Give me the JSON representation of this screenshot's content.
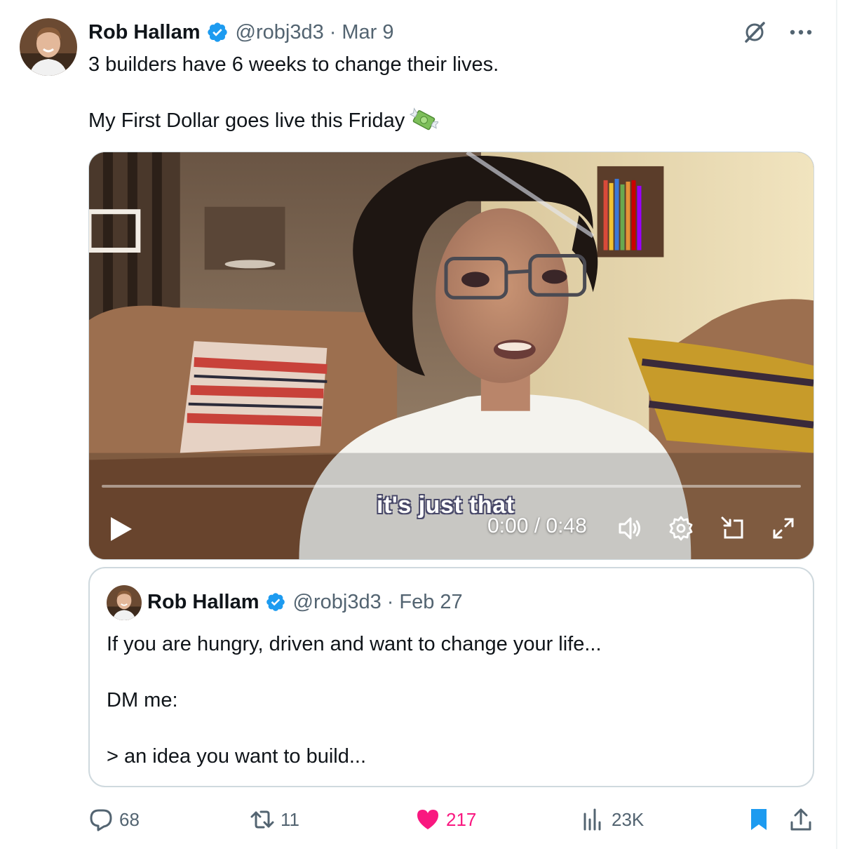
{
  "tweet": {
    "author_name": "Rob Hallam",
    "handle": "@robj3d3",
    "separator": "·",
    "date": "Mar 9",
    "text_line1": "3 builders have 6 weeks to change their lives.",
    "text_line2": "My First Dollar goes live this Friday",
    "emoji": "money-with-wings-icon"
  },
  "video": {
    "caption": "it's just that",
    "time": "0:00 / 0:48",
    "progress": 0
  },
  "quote": {
    "author_name": "Rob Hallam",
    "handle": "@robj3d3",
    "separator": "·",
    "date": "Feb 27",
    "line1": "If you are hungry, driven and want to change your life...",
    "line2": "DM me:",
    "line3": "> an idea you want to build..."
  },
  "actions": {
    "replies": "68",
    "reposts": "11",
    "likes": "217",
    "views": "23K"
  },
  "colors": {
    "verified": "#1d9bf0",
    "like": "#f91880",
    "muted": "#536471",
    "bookmark": "#1d9bf0"
  }
}
